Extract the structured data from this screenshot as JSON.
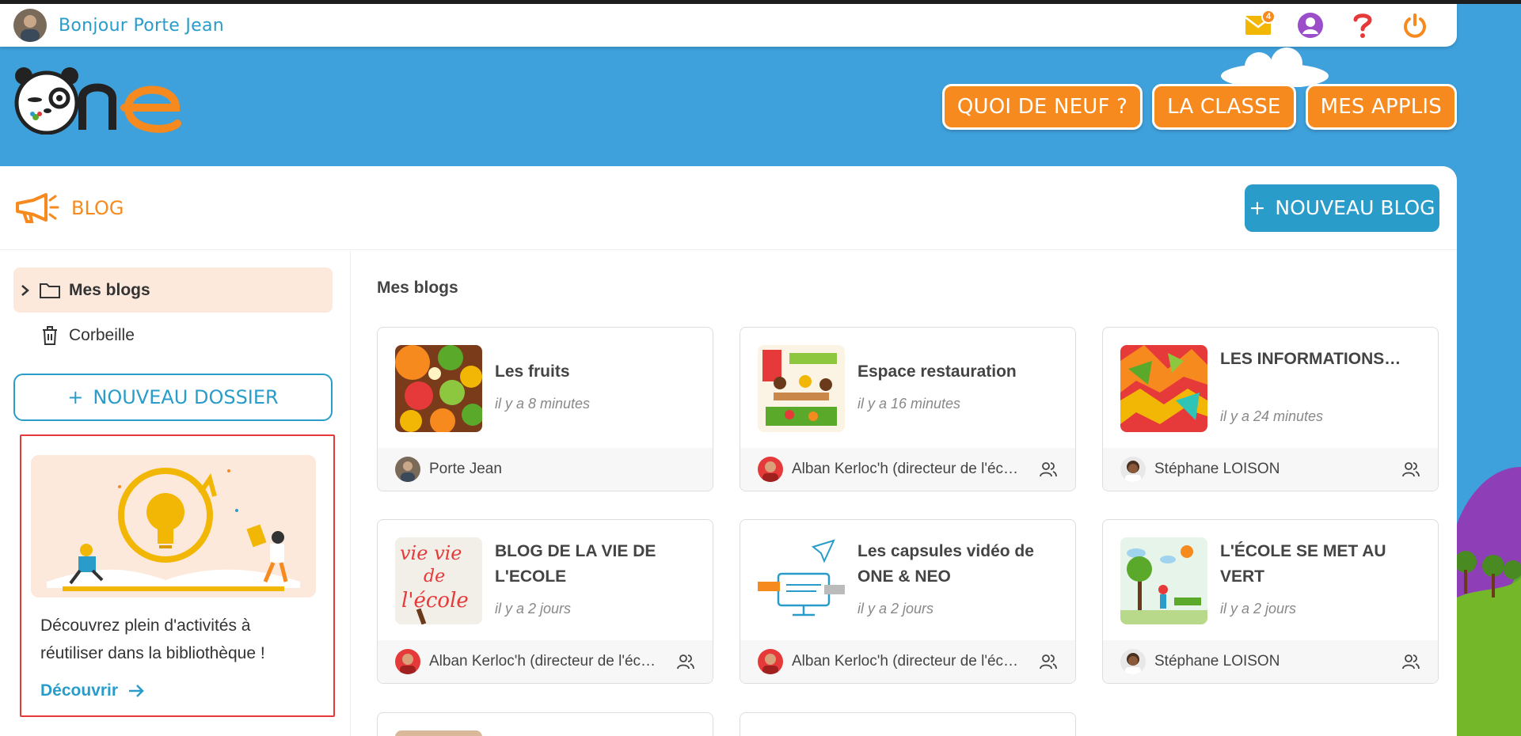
{
  "topbar": {
    "greeting": "Bonjour Porte Jean",
    "mail_badge": "4",
    "icons": [
      "mail-icon",
      "user-icon",
      "help-icon",
      "power-icon"
    ]
  },
  "nav": {
    "buttons": [
      "QUOI DE NEUF ?",
      "LA CLASSE",
      "MES APPLIS"
    ]
  },
  "app": {
    "title": "BLOG",
    "new_blog_label": "NOUVEAU BLOG"
  },
  "sidebar": {
    "items": [
      {
        "label": "Mes blogs",
        "icon": "folder-icon",
        "active": true
      },
      {
        "label": "Corbeille",
        "icon": "trash-icon",
        "active": false
      }
    ],
    "new_folder_label": "NOUVEAU DOSSIER",
    "promo": {
      "text": "Découvrez plein d'activités à réutiliser dans la bibliothèque !",
      "link": "Découvrir"
    }
  },
  "main": {
    "title": "Mes blogs",
    "cards": [
      {
        "title": "Les fruits",
        "date": "il y a 8 minutes",
        "author": "Porte Jean",
        "shared": false
      },
      {
        "title": "Espace restauration",
        "date": "il y a 16 minutes",
        "author": "Alban Kerloc'h (directeur de l'éc…",
        "shared": true
      },
      {
        "title": "LES INFORMATIONS…",
        "date": "il y a 24 minutes",
        "author": "Stéphane LOISON",
        "shared": true
      },
      {
        "title": "BLOG DE LA VIE DE L'ECOLE",
        "date": "il y a 2 jours",
        "author": "Alban Kerloc'h (directeur de l'éc…",
        "shared": true
      },
      {
        "title": "Les capsules vidéo de ONE & NEO",
        "date": "il y a 2 jours",
        "author": "Alban Kerloc'h (directeur de l'éc…",
        "shared": true
      },
      {
        "title": "L'ÉCOLE SE MET AU VERT",
        "date": "il y a 2 jours",
        "author": "Stéphane LOISON",
        "shared": true
      }
    ]
  },
  "colors": {
    "accent_orange": "#f68a1e",
    "accent_blue": "#2a9cc9",
    "background": "#3fa1dc"
  }
}
